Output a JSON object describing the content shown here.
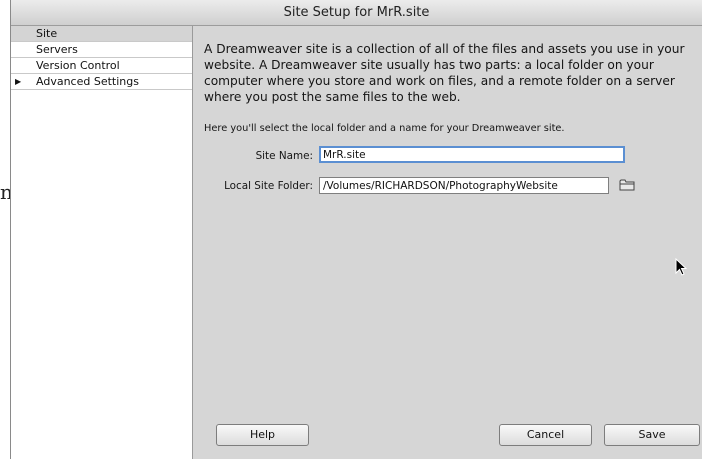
{
  "background": {
    "glyph": "n"
  },
  "window": {
    "title": "Site Setup for MrR.site"
  },
  "sidebar": {
    "items": [
      {
        "label": "Site",
        "selected": true
      },
      {
        "label": "Servers"
      },
      {
        "label": "Version Control"
      },
      {
        "label": "Advanced Settings",
        "expandable": true
      }
    ]
  },
  "main": {
    "intro": "A Dreamweaver site is a collection of all of the files and assets you use in your website. A Dreamweaver site usually has two parts: a local folder on your computer where you store and work on files, and a remote folder on a server where you post the same files to the web.",
    "hint": "Here you'll select the local folder and a name for your Dreamweaver site.",
    "site_name_label": "Site Name:",
    "site_name_value": "MrR.site",
    "local_folder_label": "Local Site Folder:",
    "local_folder_value": "/Volumes/RICHARDSON/PhotographyWebsite",
    "browse_icon": "folder-icon"
  },
  "footer": {
    "help_label": "Help",
    "cancel_label": "Cancel",
    "save_label": "Save"
  },
  "colors": {
    "dialog_bg": "#d6d6d6",
    "focus_ring": "#5b8fd2"
  }
}
